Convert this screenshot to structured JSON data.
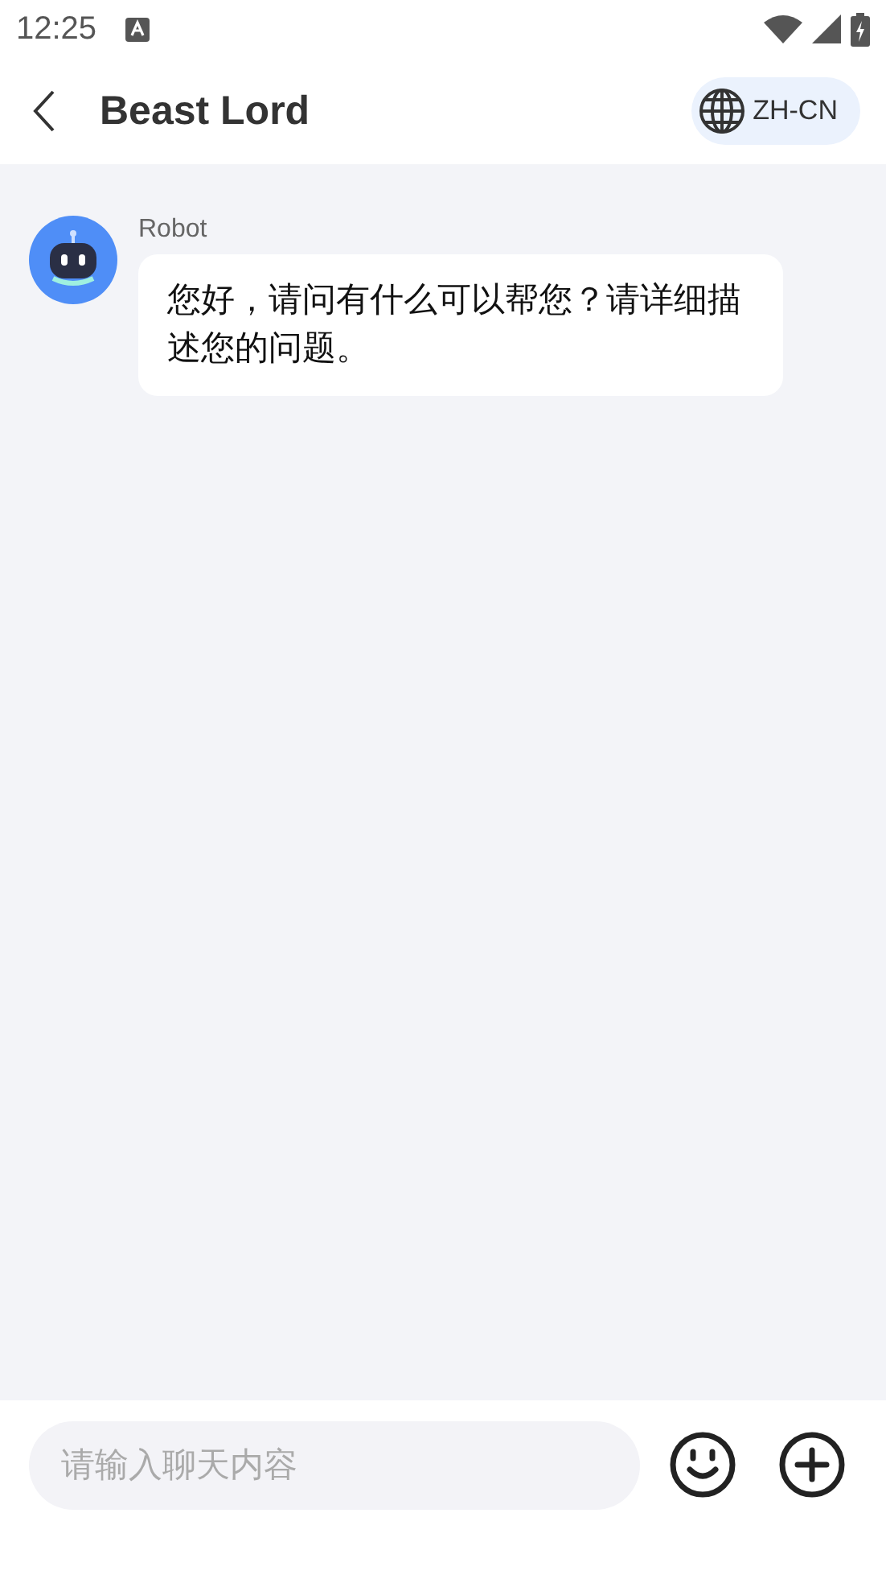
{
  "status_bar": {
    "time": "12:25"
  },
  "header": {
    "title": "Beast Lord",
    "language": "ZH-CN"
  },
  "messages": [
    {
      "sender": "Robot",
      "text": "您好，请问有什么可以帮您？请详细描述您的问题。"
    }
  ],
  "composer": {
    "placeholder": "请输入聊天内容"
  }
}
